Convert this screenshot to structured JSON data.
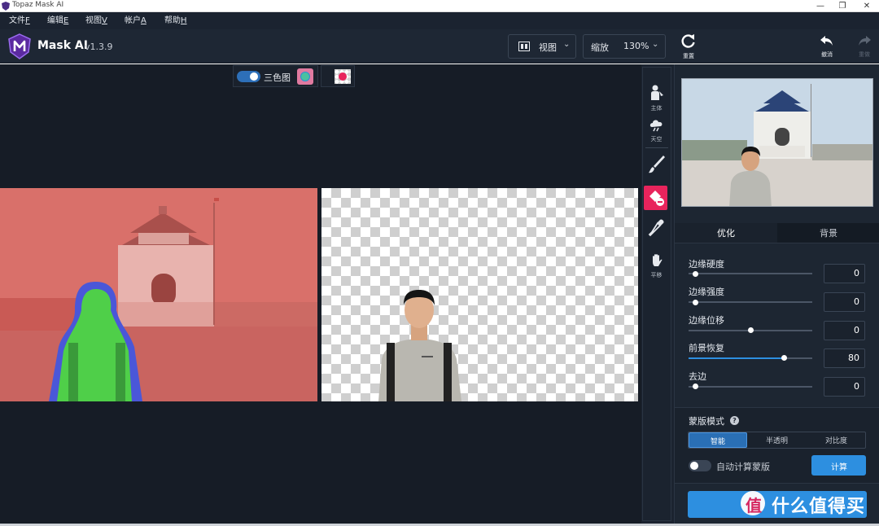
{
  "window": {
    "title": "Topaz Mask AI",
    "controls": [
      "—",
      "❐",
      "✕"
    ]
  },
  "menu": [
    {
      "label": "文件",
      "key": "F"
    },
    {
      "label": "编辑",
      "key": "E"
    },
    {
      "label": "视图",
      "key": "V"
    },
    {
      "label": "帐户",
      "key": "A"
    },
    {
      "label": "帮助",
      "key": "H"
    }
  ],
  "header": {
    "app_name": "Mask AI",
    "version": "v1.3.9",
    "view_label": "视图",
    "zoom_label": "缩放",
    "zoom_value": "130%"
  },
  "top_actions": {
    "reset": "重置",
    "undo": "撤消",
    "redo": "重做"
  },
  "canvas_controls": {
    "trimap_label": "三色图"
  },
  "tools": [
    {
      "name": "subject",
      "label": "主体"
    },
    {
      "name": "sky",
      "label": "天空"
    },
    {
      "name": "brush",
      "label": ""
    },
    {
      "name": "fill",
      "label": ""
    },
    {
      "name": "eyedropper",
      "label": ""
    },
    {
      "name": "pan",
      "label": "平移"
    }
  ],
  "tabs": {
    "refine": "优化",
    "background": "背景"
  },
  "sliders": [
    {
      "label": "边缘硬度",
      "value": "0",
      "fraction": 0.0
    },
    {
      "label": "边缘强度",
      "value": "0",
      "fraction": 0.0
    },
    {
      "label": "边缘位移",
      "value": "0",
      "fraction": 0.5
    },
    {
      "label": "前景恢复",
      "value": "80",
      "fraction": 0.8
    },
    {
      "label": "去边",
      "value": "0",
      "fraction": 0.0
    }
  ],
  "mask_mode": {
    "title": "蒙版模式",
    "options": [
      "智能",
      "半透明",
      "对比度"
    ],
    "selected": "智能"
  },
  "auto_compute": {
    "label": "自动计算蒙版",
    "enabled": false
  },
  "compute_button": "计算",
  "watermark": "什么值得买",
  "colors": {
    "accent": "#2d8fe0",
    "fill_tool_active": "#e8245c",
    "overlay_red": "#d9655f",
    "overlay_green": "#4ed04a",
    "overlay_blue": "#4a57d8"
  }
}
